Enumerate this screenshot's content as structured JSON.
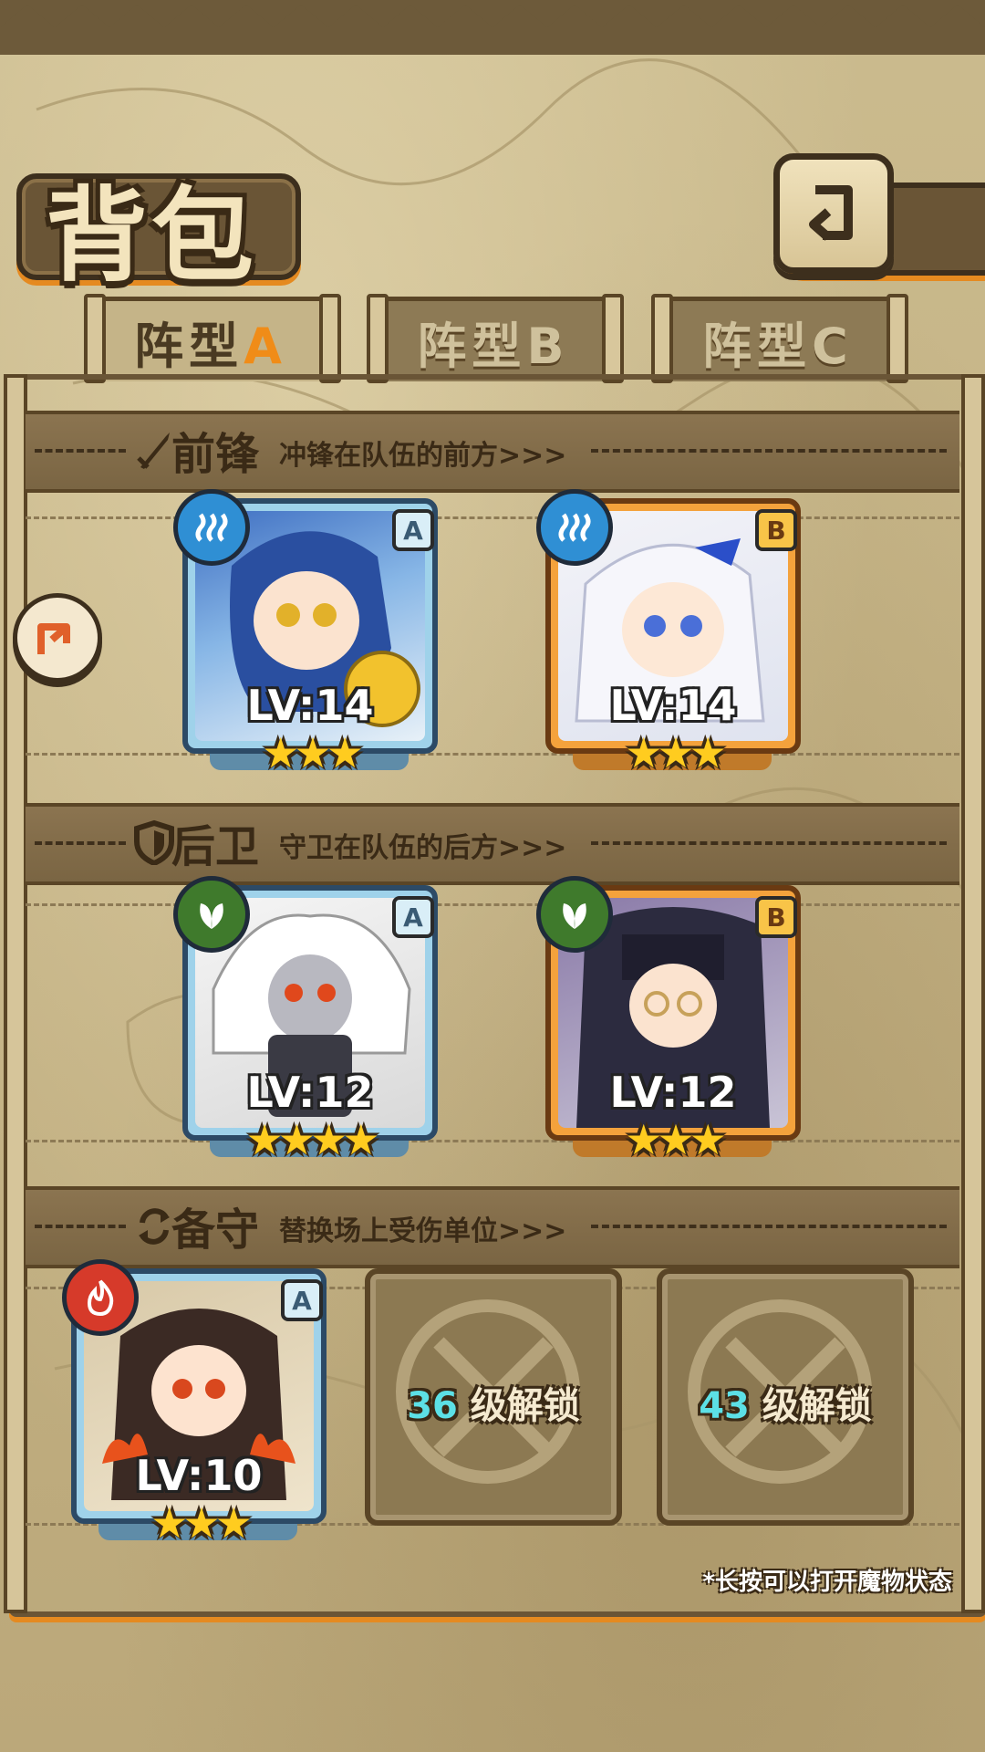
{
  "header": {
    "title": "背包",
    "back_icon": "return-arrow-icon"
  },
  "tabs": [
    {
      "label": "阵型",
      "letter": "A",
      "active": true
    },
    {
      "label": "阵型",
      "letter": "B",
      "active": false
    },
    {
      "label": "阵型",
      "letter": "C",
      "active": false
    }
  ],
  "sections": {
    "front": {
      "icon": "sword-icon",
      "title": "前锋",
      "desc": "冲锋在队伍的前方>>>"
    },
    "rear": {
      "icon": "shield-icon",
      "title": "后卫",
      "desc": "守卫在队伍的后方>>>"
    },
    "reserve": {
      "icon": "swap-arrows-icon",
      "title": "备守",
      "desc": "替换场上受伤单位>>>"
    }
  },
  "units": {
    "front_1": {
      "level": "LV:14",
      "rank": "A",
      "element": "water-icon",
      "stars": 3
    },
    "front_2": {
      "level": "LV:14",
      "rank": "B",
      "element": "water-icon",
      "stars": 3
    },
    "rear_1": {
      "level": "LV:12",
      "rank": "A",
      "element": "leaf-icon",
      "stars": 4
    },
    "rear_2": {
      "level": "LV:12",
      "rank": "B",
      "element": "leaf-icon",
      "stars": 3
    },
    "reserve_1": {
      "level": "LV:10",
      "rank": "A",
      "element": "fire-icon",
      "stars": 3
    }
  },
  "locked": [
    {
      "level": "36",
      "text": "级解锁"
    },
    {
      "level": "43",
      "text": "级解锁"
    }
  ],
  "hint": "*长按可以打开魔物状态",
  "colors": {
    "accent_orange": "#e58a20",
    "water": "#2f8fd4",
    "leaf": "#3f7a2c",
    "fire": "#d63a2a"
  }
}
